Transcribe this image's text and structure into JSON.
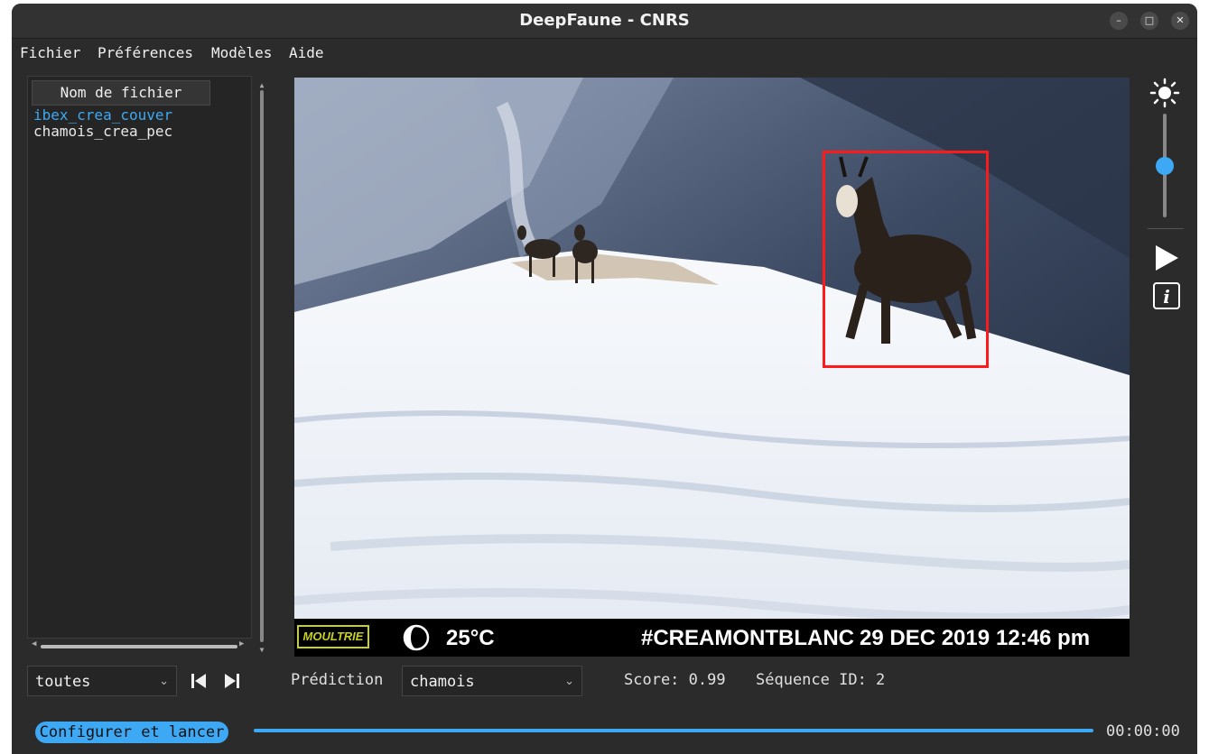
{
  "window": {
    "title": "DeepFaune - CNRS",
    "controls": {
      "minimize": "–",
      "maximize": "□",
      "close": "✕"
    }
  },
  "menu": [
    "Fichier",
    "Préférences",
    "Modèles",
    "Aide"
  ],
  "file_list": {
    "header": "Nom de fichier",
    "files": [
      {
        "name": "ibex_crea_couver",
        "selected": true
      },
      {
        "name": "chamois_crea_pec",
        "selected": false
      }
    ]
  },
  "filter": {
    "selected": "toutes"
  },
  "prediction": {
    "label": "Prédiction",
    "selected": "chamois",
    "score_text": "Score: 0.99",
    "sequence_text": "Séquence ID: 2"
  },
  "camera_stamp": {
    "brand": "MOULTRIE",
    "temperature": "25°C",
    "location": "#CREAMONTBLANC",
    "date": "29 DEC 2019",
    "time": "12:46 pm"
  },
  "brightness": {
    "level": 0.5
  },
  "run": {
    "label": "Configurer et lancer",
    "elapsed": "00:00:00"
  },
  "colors": {
    "accent": "#3da9f4",
    "bbox": "#ff1a1a",
    "window_bg": "#2b2b2b",
    "stamp_brand": "#c9d11f"
  },
  "icons": [
    "brightness-icon",
    "play-icon",
    "info-icon",
    "skip-previous-icon",
    "skip-next-icon",
    "moon-icon"
  ]
}
